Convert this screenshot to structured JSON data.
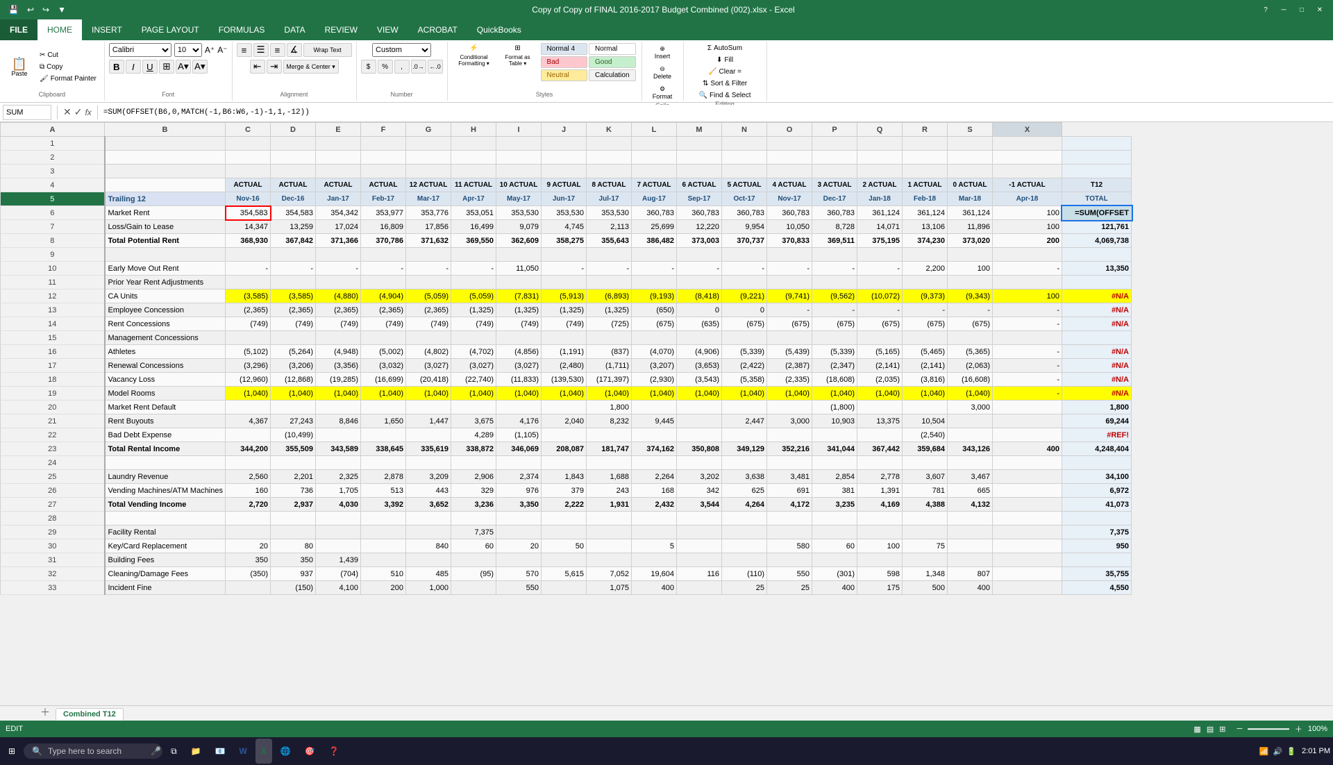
{
  "window": {
    "title": "Copy of Copy of FINAL 2016-2017 Budget Combined (002).xlsx - Excel",
    "quick_access": [
      "save",
      "undo",
      "redo",
      "customize"
    ]
  },
  "ribbon": {
    "tabs": [
      "FILE",
      "HOME",
      "INSERT",
      "PAGE LAYOUT",
      "FORMULAS",
      "DATA",
      "REVIEW",
      "VIEW",
      "ACROBAT",
      "QuickBooks"
    ],
    "active_tab": "HOME",
    "groups": {
      "clipboard": {
        "label": "Clipboard",
        "paste_label": "Paste",
        "cut_label": "Cut",
        "copy_label": "Copy",
        "format_painter_label": "Format Painter"
      },
      "font": {
        "label": "Font",
        "font_name": "Calibri",
        "font_size": "10"
      },
      "alignment": {
        "label": "Alignment",
        "wrap_text": "Wrap Text",
        "merge_center": "Merge & Center"
      },
      "number": {
        "label": "Number",
        "format": "Custom"
      },
      "styles": {
        "label": "Styles",
        "conditional_formatting": "Conditional Formatting",
        "format_as_table": "Format as Table",
        "normal4": "Normal 4",
        "normal": "Normal",
        "bad": "Bad",
        "good": "Good",
        "neutral": "Neutral",
        "calculation": "Calculation"
      },
      "cells": {
        "label": "Cells",
        "insert": "Insert",
        "delete": "Delete",
        "format": "Format"
      },
      "editing": {
        "label": "Editing",
        "autosum": "AutoSum",
        "fill": "Fill",
        "clear": "Clear =",
        "sort_filter": "Sort & Filter",
        "find_select": "Find & Select"
      }
    }
  },
  "formula_bar": {
    "name_box": "SUM",
    "formula": "=SUM(OFFSET(B6,0,MATCH(-1,B6:W6,-1)-1,1,-12))"
  },
  "columns": {
    "headers": [
      "A",
      "B",
      "C",
      "D",
      "E",
      "F",
      "G",
      "H",
      "I",
      "J",
      "K",
      "L",
      "M",
      "N",
      "O",
      "P",
      "Q",
      "R",
      "S",
      "X"
    ],
    "widths": [
      150,
      65,
      65,
      65,
      65,
      65,
      65,
      65,
      65,
      65,
      65,
      65,
      65,
      65,
      65,
      65,
      65,
      65,
      65,
      100
    ]
  },
  "rows": [
    {
      "num": 1,
      "cells": []
    },
    {
      "num": 2,
      "cells": []
    },
    {
      "num": 3,
      "cells": []
    },
    {
      "num": 4,
      "label": "",
      "cols": {
        "B": "ACTUAL",
        "C": "ACTUAL",
        "D": "ACTUAL",
        "E": "ACTUAL",
        "F": "12 ACTUAL",
        "G": "11 ACTUAL",
        "H": "10 ACTUAL",
        "I": "9 ACTUAL",
        "J": "8 ACTUAL",
        "K": "7 ACTUAL",
        "L": "6 ACTUAL",
        "M": "5 ACTUAL",
        "N": "4 ACTUAL",
        "O": "3 ACTUAL",
        "P": "2 ACTUAL",
        "Q": "1 ACTUAL",
        "R": "0 ACTUAL",
        "S": "-1 ACTUAL",
        "X": "T12"
      }
    },
    {
      "num": 5,
      "label": "Trailing 12",
      "cols": {
        "B": "Nov-16",
        "C": "Dec-16",
        "D": "Jan-17",
        "E": "Feb-17",
        "F": "Mar-17",
        "G": "Apr-17",
        "H": "May-17",
        "I": "Jun-17",
        "J": "Jul-17",
        "K": "Aug-17",
        "L": "Sep-17",
        "M": "Oct-17",
        "N": "Nov-17",
        "O": "Dec-17",
        "P": "Jan-18",
        "Q": "Feb-18",
        "R": "Mar-18",
        "S": "Apr-18",
        "X": "TOTAL"
      }
    },
    {
      "num": 6,
      "label": "Market Rent",
      "cols": {
        "B": "354,583",
        "C": "354,583",
        "D": "354,342",
        "E": "353,977",
        "F": "353,776",
        "G": "353,051",
        "H": "353,530",
        "I": "353,530",
        "J": "353,530",
        "K": "360,783",
        "L": "360,783",
        "M": "360,783",
        "N": "360,783",
        "O": "360,783",
        "P": "361,124",
        "Q": "361,124",
        "R": "361,124",
        "S": "100",
        "X": "=SUM(OFFSET"
      }
    },
    {
      "num": 7,
      "label": "Loss/Gain to Lease",
      "cols": {
        "B": "14,347",
        "C": "13,259",
        "D": "17,024",
        "E": "16,809",
        "F": "17,856",
        "G": "16,499",
        "H": "9,079",
        "I": "4,745",
        "J": "2,113",
        "K": "25,699",
        "L": "12,220",
        "M": "9,954",
        "N": "10,050",
        "O": "8,728",
        "P": "14,071",
        "Q": "13,106",
        "R": "11,896",
        "S": "100",
        "X": "121,761"
      }
    },
    {
      "num": 8,
      "label": "Total Potential Rent",
      "bold": true,
      "cols": {
        "B": "368,930",
        "C": "367,842",
        "D": "371,366",
        "E": "370,786",
        "F": "371,632",
        "G": "369,550",
        "H": "362,609",
        "I": "358,275",
        "J": "355,643",
        "K": "386,482",
        "L": "373,003",
        "M": "370,737",
        "N": "370,833",
        "O": "369,511",
        "P": "375,195",
        "Q": "374,230",
        "R": "373,020",
        "S": "200",
        "X": "4,069,738"
      }
    },
    {
      "num": 9,
      "cells": []
    },
    {
      "num": 10,
      "label": "Early Move Out Rent",
      "cols": {
        "B": "-",
        "C": "-",
        "D": "-",
        "E": "-",
        "F": "-",
        "G": "-",
        "H": "11,050",
        "I": "-",
        "J": "-",
        "K": "-",
        "L": "-",
        "M": "-",
        "N": "-",
        "O": "-",
        "P": "-",
        "Q": "2,200",
        "R": "100",
        "S": "-",
        "X": "13,350"
      }
    },
    {
      "num": 11,
      "label": "Prior Year Rent Adjustments",
      "cols": {}
    },
    {
      "num": 12,
      "label": "CA Units",
      "yellow": true,
      "cols": {
        "B": "(3,585)",
        "C": "(3,585)",
        "D": "(4,880)",
        "E": "(4,904)",
        "F": "(5,059)",
        "G": "(5,059)",
        "H": "(7,831)",
        "I": "(5,913)",
        "J": "(6,893)",
        "K": "(9,193)",
        "L": "(8,418)",
        "M": "(9,221)",
        "N": "(9,741)",
        "O": "(9,562)",
        "P": "(10,072)",
        "Q": "(9,373)",
        "R": "(9,343)",
        "S": "100",
        "X": "#N/A"
      }
    },
    {
      "num": 13,
      "label": "Employee Concession",
      "cols": {
        "B": "(2,365)",
        "C": "(2,365)",
        "D": "(2,365)",
        "E": "(2,365)",
        "F": "(2,365)",
        "G": "(1,325)",
        "H": "(1,325)",
        "I": "(1,325)",
        "J": "(1,325)",
        "K": "(650)",
        "L": "0",
        "M": "0",
        "N": "-",
        "O": "-",
        "P": "-",
        "Q": "-",
        "R": "-",
        "S": "-",
        "X": "#N/A"
      }
    },
    {
      "num": 14,
      "label": "Rent Concessions",
      "cols": {
        "B": "(749)",
        "C": "(749)",
        "D": "(749)",
        "E": "(749)",
        "F": "(749)",
        "G": "(749)",
        "H": "(749)",
        "I": "(749)",
        "J": "(725)",
        "K": "(675)",
        "L": "(635)",
        "M": "(675)",
        "N": "(675)",
        "O": "(675)",
        "P": "(675)",
        "Q": "(675)",
        "R": "(675)",
        "S": "-",
        "X": "#N/A"
      }
    },
    {
      "num": 15,
      "label": "Management Concessions",
      "cols": {}
    },
    {
      "num": 16,
      "label": "Athletes",
      "cols": {
        "B": "(5,102)",
        "C": "(5,264)",
        "D": "(4,948)",
        "E": "(5,002)",
        "F": "(4,802)",
        "G": "(4,702)",
        "H": "(4,856)",
        "I": "(1,191)",
        "J": "(837)",
        "K": "(4,070)",
        "L": "(4,906)",
        "M": "(5,339)",
        "N": "(5,439)",
        "O": "(5,339)",
        "P": "(5,165)",
        "Q": "(5,465)",
        "R": "(5,365)",
        "S": "-",
        "X": "#N/A"
      }
    },
    {
      "num": 17,
      "label": "Renewal Concessions",
      "cols": {
        "B": "(3,296)",
        "C": "(3,206)",
        "D": "(3,356)",
        "E": "(3,032)",
        "F": "(3,027)",
        "G": "(3,027)",
        "H": "(3,027)",
        "I": "(2,480)",
        "J": "(1,711)",
        "K": "(3,207)",
        "L": "(3,653)",
        "M": "(2,422)",
        "N": "(2,387)",
        "O": "(2,347)",
        "P": "(2,141)",
        "Q": "(2,141)",
        "R": "(2,063)",
        "S": "-",
        "X": "#N/A"
      }
    },
    {
      "num": 18,
      "label": "Vacancy Loss",
      "cols": {
        "B": "(12,960)",
        "C": "(12,868)",
        "D": "(19,285)",
        "E": "(16,699)",
        "F": "(20,418)",
        "G": "(22,740)",
        "H": "(11,833)",
        "I": "(139,530)",
        "J": "(171,397)",
        "K": "(2,930)",
        "L": "(3,543)",
        "M": "(5,358)",
        "N": "(2,335)",
        "O": "(18,608)",
        "P": "(2,035)",
        "Q": "(3,816)",
        "R": "(16,608)",
        "S": "-",
        "X": "#N/A"
      }
    },
    {
      "num": 19,
      "label": "Model Rooms",
      "yellow": true,
      "cols": {
        "B": "(1,040)",
        "C": "(1,040)",
        "D": "(1,040)",
        "E": "(1,040)",
        "F": "(1,040)",
        "G": "(1,040)",
        "H": "(1,040)",
        "I": "(1,040)",
        "J": "(1,040)",
        "K": "(1,040)",
        "L": "(1,040)",
        "M": "(1,040)",
        "N": "(1,040)",
        "O": "(1,040)",
        "P": "(1,040)",
        "Q": "(1,040)",
        "R": "(1,040)",
        "S": "-",
        "X": "#N/A"
      }
    },
    {
      "num": 20,
      "label": "Market Rent Default",
      "cols": {
        "J": "1,800",
        "O": "(1,800)",
        "R": "3,000",
        "X": "1,800"
      }
    },
    {
      "num": 21,
      "label": "Rent Buyouts",
      "cols": {
        "B": "4,367",
        "C": "27,243",
        "D": "8,846",
        "E": "1,650",
        "F": "1,447",
        "G": "3,675",
        "H": "4,176",
        "I": "2,040",
        "J": "8,232",
        "K": "9,445",
        "M": "2,447",
        "N": "3,000",
        "O": "10,903",
        "P": "13,375",
        "Q": "10,504",
        "X": "69,244"
      }
    },
    {
      "num": 22,
      "label": "Bad Debt Expense",
      "cols": {
        "C": "(10,499)",
        "G": "4,289",
        "H": "(1,105)",
        "Q": "(2,540)",
        "X": "#REF!"
      }
    },
    {
      "num": 23,
      "label": "Total Rental Income",
      "bold": true,
      "cols": {
        "B": "344,200",
        "C": "355,509",
        "D": "343,589",
        "E": "338,645",
        "F": "335,619",
        "G": "338,872",
        "H": "346,069",
        "I": "208,087",
        "J": "181,747",
        "K": "374,162",
        "L": "350,808",
        "M": "349,129",
        "N": "352,216",
        "O": "341,044",
        "P": "367,442",
        "Q": "359,684",
        "R": "343,126",
        "S": "400",
        "X": "4,248,404"
      }
    },
    {
      "num": 24,
      "cells": []
    },
    {
      "num": 25,
      "label": "Laundry Revenue",
      "cols": {
        "B": "2,560",
        "C": "2,201",
        "D": "2,325",
        "E": "2,878",
        "F": "3,209",
        "G": "2,906",
        "H": "2,374",
        "I": "1,843",
        "J": "1,688",
        "K": "2,264",
        "L": "3,202",
        "M": "3,638",
        "N": "3,481",
        "O": "2,854",
        "P": "2,778",
        "Q": "3,607",
        "R": "3,467",
        "X": "34,100"
      }
    },
    {
      "num": 26,
      "label": "Vending Machines/ATM Machines",
      "cols": {
        "B": "160",
        "C": "736",
        "D": "1,705",
        "E": "513",
        "F": "443",
        "G": "329",
        "H": "976",
        "I": "379",
        "J": "243",
        "K": "168",
        "L": "342",
        "M": "625",
        "N": "691",
        "O": "381",
        "P": "1,391",
        "Q": "781",
        "R": "665",
        "X": "6,972"
      }
    },
    {
      "num": 27,
      "label": "Total Vending Income",
      "bold": true,
      "cols": {
        "B": "2,720",
        "C": "2,937",
        "D": "4,030",
        "E": "3,392",
        "F": "3,652",
        "G": "3,236",
        "H": "3,350",
        "I": "2,222",
        "J": "1,931",
        "K": "2,432",
        "L": "3,544",
        "M": "4,264",
        "N": "4,172",
        "O": "3,235",
        "P": "4,169",
        "Q": "4,388",
        "R": "4,132",
        "X": "41,073"
      }
    },
    {
      "num": 28,
      "cells": []
    },
    {
      "num": 29,
      "label": "Facility Rental",
      "cols": {
        "G": "7,375",
        "X": "7,375"
      }
    },
    {
      "num": 30,
      "label": "Key/Card Replacement",
      "cols": {
        "B": "20",
        "C": "80",
        "F": "840",
        "G": "60",
        "H": "20",
        "I": "50",
        "K": "5",
        "N": "580",
        "O": "60",
        "P": "100",
        "Q": "75",
        "X": "950"
      }
    },
    {
      "num": 31,
      "label": "Building Fees",
      "cols": {
        "B": "350",
        "C": "350",
        "D": "1,439",
        "X": ""
      }
    },
    {
      "num": 32,
      "label": "Cleaning/Damage Fees",
      "cols": {
        "B": "(350)",
        "C": "937",
        "D": "(704)",
        "E": "510",
        "F": "485",
        "G": "(95)",
        "H": "570",
        "I": "5,615",
        "J": "7,052",
        "K": "19,604",
        "L": "116",
        "M": "(110)",
        "N": "550",
        "O": "(301)",
        "P": "598",
        "Q": "1,348",
        "R": "807",
        "X": "35,755"
      }
    },
    {
      "num": 33,
      "label": "Incident Fine",
      "cols": {
        "C": "(150)",
        "D": "4,100",
        "E": "200",
        "F": "1,000",
        "H": "550",
        "J": "1,075",
        "K": "400",
        "M": "25",
        "N": "25",
        "O": "400",
        "P": "175",
        "Q": "500",
        "R": "400",
        "X": "4,550"
      }
    }
  ],
  "sheet_tabs": [
    "Combined T12"
  ],
  "active_sheet": "Combined T12",
  "status_bar": {
    "mode": "EDIT",
    "time": "2:01 PM",
    "zoom": "100%"
  },
  "taskbar": {
    "start_label": "⊞",
    "search_placeholder": "Type here to search",
    "apps": [
      "⊞",
      "🔍",
      "📁",
      "📧",
      "📄",
      "📊",
      "🌐",
      "🎯",
      "❓"
    ]
  }
}
